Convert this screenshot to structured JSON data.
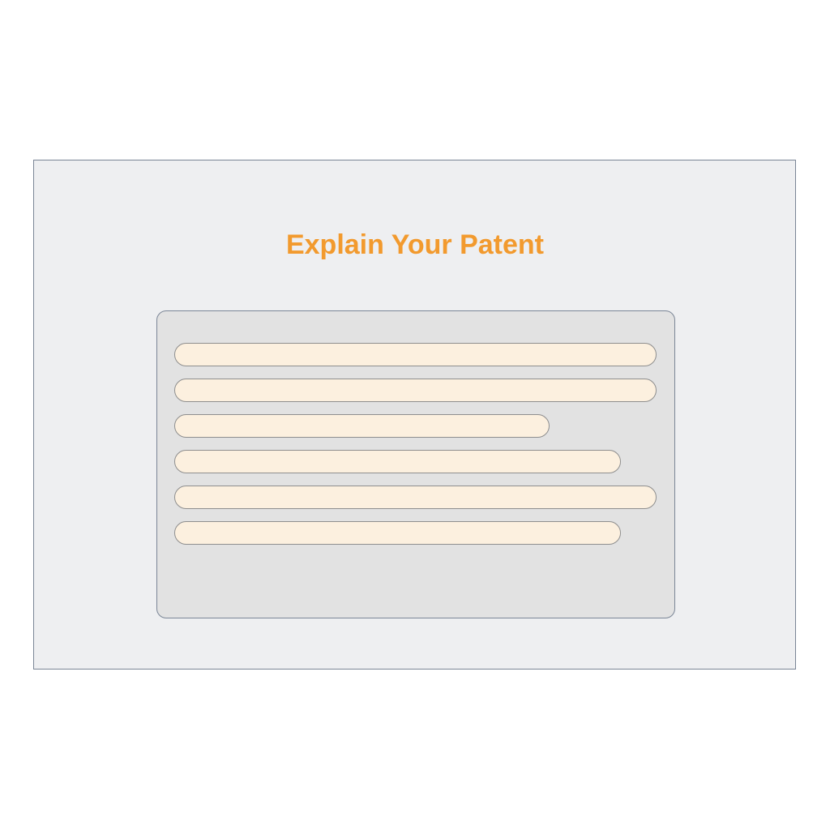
{
  "title": "Explain Your Patent",
  "colors": {
    "title": "#f29a2e",
    "frame_background": "#eeeff1",
    "panel_background": "#e2e2e2",
    "bar_fill": "#fcf0df"
  },
  "text_lines": [
    {
      "placeholder": true
    },
    {
      "placeholder": true
    },
    {
      "placeholder": true
    },
    {
      "placeholder": true
    },
    {
      "placeholder": true
    },
    {
      "placeholder": true
    }
  ]
}
